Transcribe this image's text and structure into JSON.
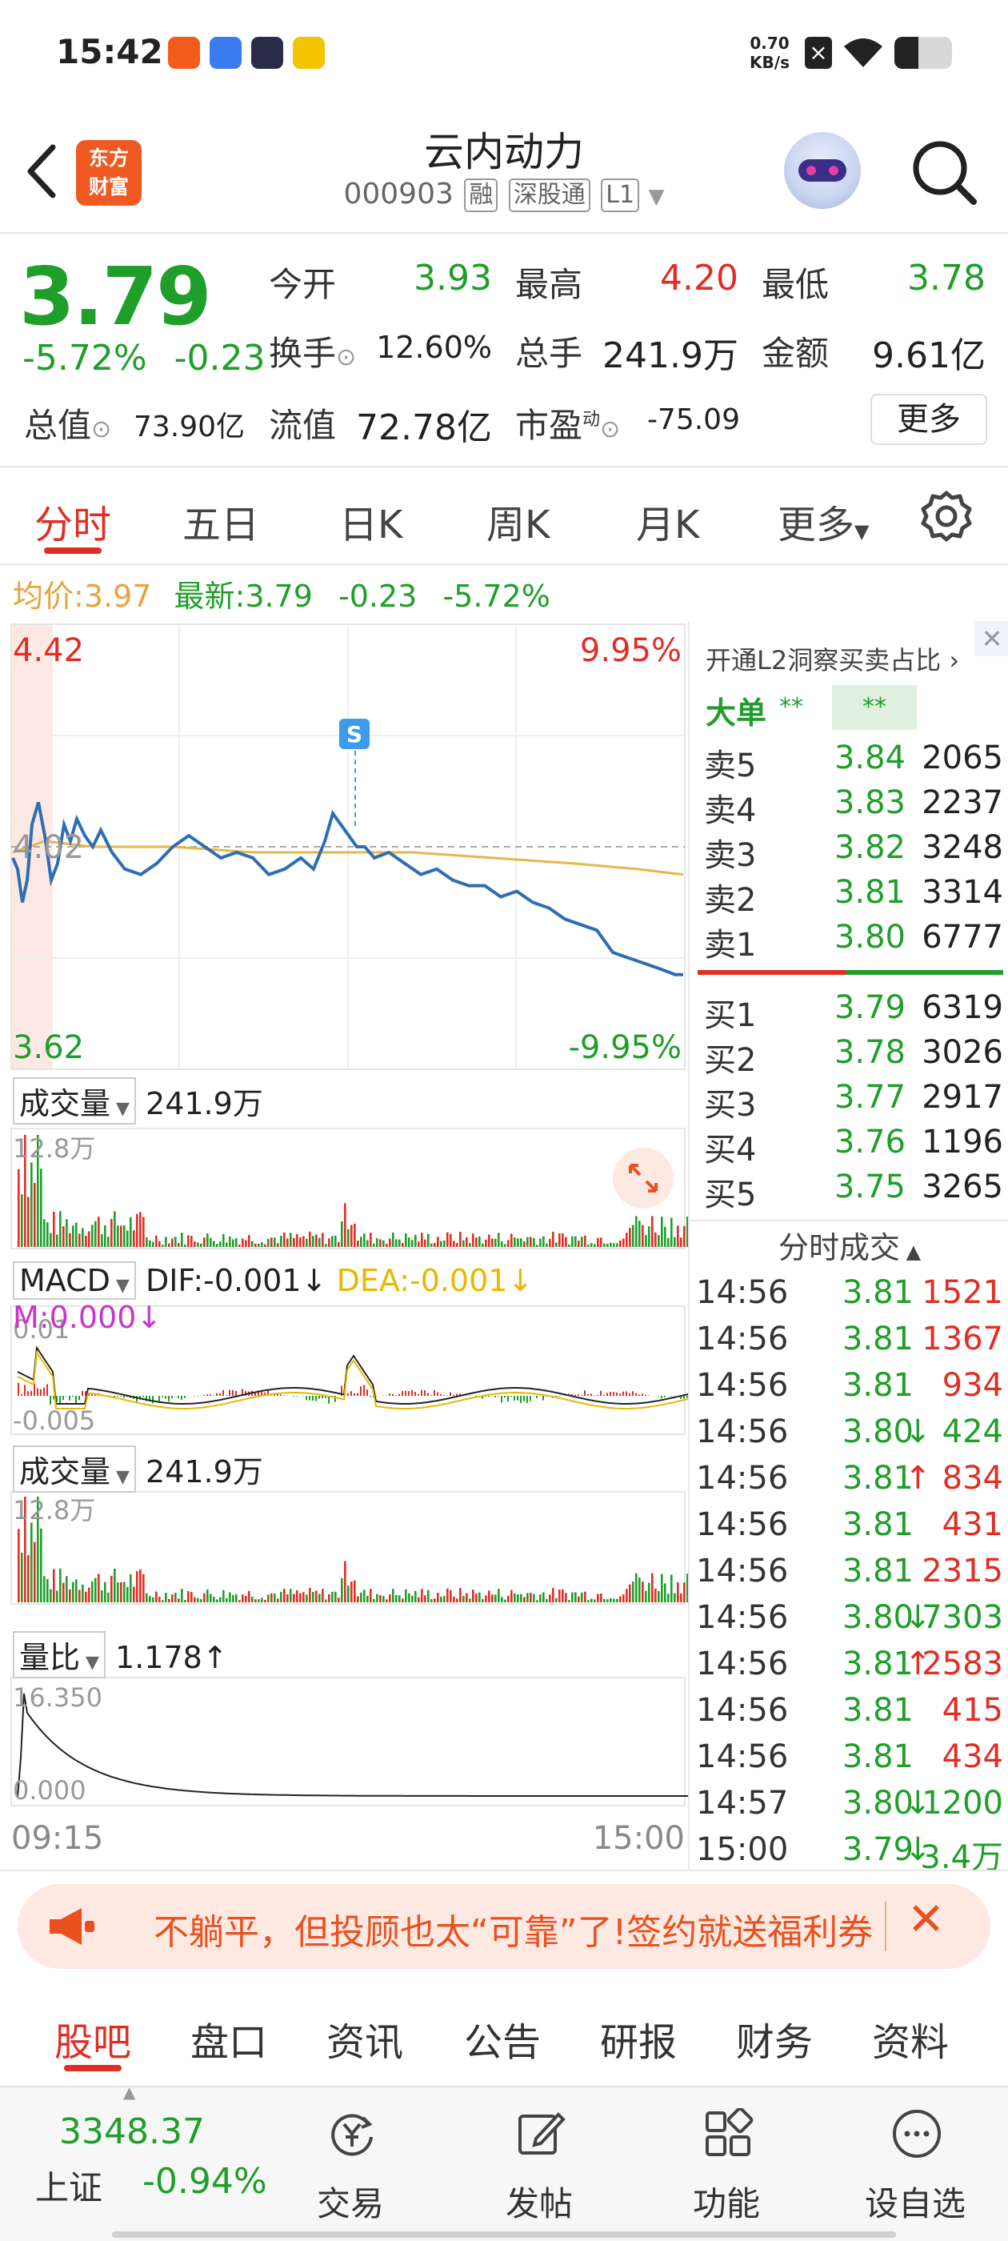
{
  "status_bar": {
    "time": "15:42",
    "net_speed_value": "0.70",
    "net_speed_unit": "KB/s"
  },
  "header": {
    "logo_line1": "东方",
    "logo_line2": "财富",
    "stock_name": "云内动力",
    "stock_code": "000903",
    "tag_margin": "融",
    "tag_connect": "深股通",
    "tag_level": "L1"
  },
  "quote": {
    "price": "3.79",
    "change_pct": "-5.72%",
    "change_amt": "-0.23",
    "open_label": "今开",
    "open": "3.93",
    "high_label": "最高",
    "high": "4.20",
    "low_label": "最低",
    "low": "3.78",
    "turnover_rate_label": "换手",
    "turnover_rate": "12.60%",
    "volume_label": "总手",
    "volume": "241.9万",
    "amount_label": "金额",
    "amount": "9.61亿",
    "mktcap_label": "总值",
    "mktcap": "73.90亿",
    "float_label": "流值",
    "float_cap": "72.78亿",
    "pe_label": "市盈",
    "pe_sup": "动",
    "pe": "-75.09",
    "more_button": "更多"
  },
  "chart_tabs": [
    "分时",
    "五日",
    "日K",
    "周K",
    "月K",
    "更多"
  ],
  "avg_line": {
    "avg_label": "均价:",
    "avg": "3.97",
    "latest_label": "最新:",
    "latest": "3.79",
    "chg": "-0.23",
    "pct": "-5.72%"
  },
  "intraday": {
    "y_top": "4.42",
    "y_bottom": "3.62",
    "y_mid": "4.02",
    "pct_top": "9.95%",
    "pct_bottom": "-9.95%",
    "signal": "S",
    "time_start": "09:15",
    "time_end": "15:00"
  },
  "volume_panel": {
    "label": "成交量",
    "value": "241.9万",
    "max": "12.8万"
  },
  "macd_panel": {
    "label": "MACD",
    "dif": "DIF:-0.001",
    "dif_arrow": "↓",
    "dea": "DEA:-0.001",
    "dea_arrow": "↓",
    "m": "M:0.000",
    "m_arrow": "↓",
    "top": "0.01",
    "bottom": "-0.005"
  },
  "volume_panel2": {
    "label": "成交量",
    "value": "241.9万",
    "max": "12.8万"
  },
  "ratio_panel": {
    "label": "量比",
    "value": "1.178",
    "arrow": "↑",
    "top": "16.350",
    "bottom": "0.000"
  },
  "right_panel": {
    "l2_link": "开通L2洞察买卖占比",
    "big_order_label": "大单",
    "big_order_val1": "**",
    "big_order_val2": "**",
    "asks": [
      {
        "label": "卖5",
        "price": "3.84",
        "vol": "2065"
      },
      {
        "label": "卖4",
        "price": "3.83",
        "vol": "2237"
      },
      {
        "label": "卖3",
        "price": "3.82",
        "vol": "3248"
      },
      {
        "label": "卖2",
        "price": "3.81",
        "vol": "3314"
      },
      {
        "label": "卖1",
        "price": "3.80",
        "vol": "6777"
      }
    ],
    "bids": [
      {
        "label": "买1",
        "price": "3.79",
        "vol": "6319"
      },
      {
        "label": "买2",
        "price": "3.78",
        "vol": "3026"
      },
      {
        "label": "买3",
        "price": "3.77",
        "vol": "2917"
      },
      {
        "label": "买4",
        "price": "3.76",
        "vol": "1196"
      },
      {
        "label": "买5",
        "price": "3.75",
        "vol": "3265"
      }
    ],
    "trades_title": "分时成交",
    "trades": [
      {
        "time": "14:56",
        "price": "3.81",
        "arrow": "",
        "vol": "1521",
        "dir": "up"
      },
      {
        "time": "14:56",
        "price": "3.81",
        "arrow": "",
        "vol": "1367",
        "dir": "up"
      },
      {
        "time": "14:56",
        "price": "3.81",
        "arrow": "",
        "vol": "934",
        "dir": "up"
      },
      {
        "time": "14:56",
        "price": "3.80",
        "arrow": "↓",
        "vol": "424",
        "dir": "down"
      },
      {
        "time": "14:56",
        "price": "3.81",
        "arrow": "↑",
        "vol": "834",
        "dir": "up"
      },
      {
        "time": "14:56",
        "price": "3.81",
        "arrow": "",
        "vol": "431",
        "dir": "up"
      },
      {
        "time": "14:56",
        "price": "3.81",
        "arrow": "",
        "vol": "2315",
        "dir": "up"
      },
      {
        "time": "14:56",
        "price": "3.80",
        "arrow": "↓",
        "vol": "7303",
        "dir": "down"
      },
      {
        "time": "14:56",
        "price": "3.81",
        "arrow": "↑",
        "vol": "2583",
        "dir": "up"
      },
      {
        "time": "14:56",
        "price": "3.81",
        "arrow": "",
        "vol": "415",
        "dir": "up"
      },
      {
        "time": "14:56",
        "price": "3.81",
        "arrow": "",
        "vol": "434",
        "dir": "up"
      },
      {
        "time": "14:57",
        "price": "3.80",
        "arrow": "↓",
        "vol": "1200",
        "dir": "down"
      },
      {
        "time": "15:00",
        "price": "3.79",
        "arrow": "↓",
        "vol": "3.4万",
        "dir": "down"
      }
    ]
  },
  "banner": {
    "text": "不躺平，但投顾也太“可靠”了!签约就送福利券"
  },
  "bottom_tabs": [
    "股吧",
    "盘口",
    "资讯",
    "公告",
    "研报",
    "财务",
    "资料"
  ],
  "toolbar": {
    "index_value": "3348.37",
    "index_name": "上证",
    "index_pct": "-0.94%",
    "items": [
      "交易",
      "发帖",
      "功能",
      "设自选"
    ]
  },
  "colors": {
    "up": "#e02e24",
    "down": "#1f9e2a",
    "accent": "#f05a22",
    "price_line": "#2e6db4",
    "avg_line": "#e8b54a"
  }
}
